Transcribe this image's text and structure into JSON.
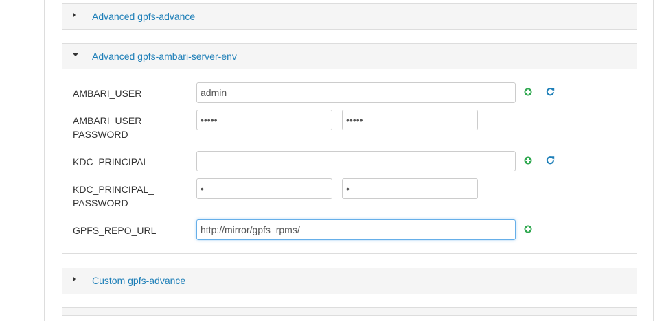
{
  "colors": {
    "link": "#1e7fb8",
    "add": "#2fa84f",
    "refresh": "#1e7fb8",
    "heading_bg": "#f5f5f5",
    "border": "#dddddd"
  },
  "sections": {
    "advanced_gpfs_advance": {
      "title": "Advanced gpfs-advance",
      "expanded": false
    },
    "advanced_ambari_server_env": {
      "title": "Advanced gpfs-ambari-server-env",
      "expanded": true,
      "fields": {
        "ambari_user": {
          "label": "AMBARI_USER",
          "value": "admin",
          "icons": [
            "add-icon",
            "refresh-icon"
          ]
        },
        "ambari_user_password": {
          "label_line1": "AMBARI_USER_",
          "label_line2": "PASSWORD",
          "value": "•••••",
          "confirm_value": "•••••"
        },
        "kdc_principal": {
          "label": "KDC_PRINCIPAL",
          "value": "",
          "icons": [
            "add-icon",
            "refresh-icon"
          ]
        },
        "kdc_principal_password": {
          "label_line1": "KDC_PRINCIPAL_",
          "label_line2": "PASSWORD",
          "value": "•",
          "confirm_value": "•"
        },
        "gpfs_repo_url": {
          "label": "GPFS_REPO_URL",
          "value": "http://mirror/gpfs_rpms/",
          "icons": [
            "add-icon"
          ]
        }
      }
    },
    "custom_gpfs_advance": {
      "title": "Custom gpfs-advance",
      "expanded": false
    }
  }
}
